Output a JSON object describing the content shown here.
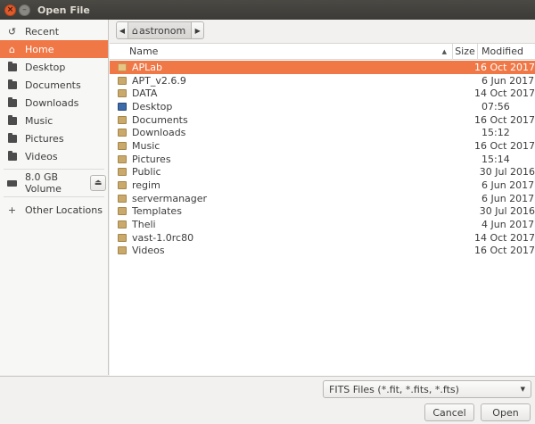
{
  "window": {
    "title": "Open File"
  },
  "sidebar": {
    "items": [
      {
        "label": "Recent",
        "icon": "recent-icon"
      },
      {
        "label": "Home",
        "icon": "home-icon",
        "selected": true
      },
      {
        "label": "Desktop",
        "icon": "folder-icon"
      },
      {
        "label": "Documents",
        "icon": "folder-icon"
      },
      {
        "label": "Downloads",
        "icon": "folder-icon"
      },
      {
        "label": "Music",
        "icon": "folder-icon"
      },
      {
        "label": "Pictures",
        "icon": "folder-icon"
      },
      {
        "label": "Videos",
        "icon": "folder-icon"
      }
    ],
    "volume": {
      "label": "8.0 GB Volume",
      "icon": "drive-icon",
      "eject_icon": "eject-icon"
    },
    "other": {
      "label": "Other Locations",
      "icon": "plus-icon"
    }
  },
  "pathbar": {
    "current": "astronom",
    "icon": "home-icon"
  },
  "columns": {
    "name": "Name",
    "size": "Size",
    "modified": "Modified"
  },
  "files": [
    {
      "name": "APLab",
      "size": "",
      "modified": "16 Oct 2017",
      "selected": true
    },
    {
      "name": "APT_v2.6.9",
      "size": "",
      "modified": "6 Jun 2017"
    },
    {
      "name": "DATA",
      "size": "",
      "modified": "14 Oct 2017"
    },
    {
      "name": "Desktop",
      "size": "",
      "modified": "07:56",
      "icon": "desktop"
    },
    {
      "name": "Documents",
      "size": "",
      "modified": "16 Oct 2017"
    },
    {
      "name": "Downloads",
      "size": "",
      "modified": "15:12"
    },
    {
      "name": "Music",
      "size": "",
      "modified": "16 Oct 2017"
    },
    {
      "name": "Pictures",
      "size": "",
      "modified": "15:14"
    },
    {
      "name": "Public",
      "size": "",
      "modified": "30 Jul 2016"
    },
    {
      "name": "regim",
      "size": "",
      "modified": "6 Jun 2017"
    },
    {
      "name": "servermanager",
      "size": "",
      "modified": "6 Jun 2017"
    },
    {
      "name": "Templates",
      "size": "",
      "modified": "30 Jul 2016"
    },
    {
      "name": "Theli",
      "size": "",
      "modified": "4 Jun 2017"
    },
    {
      "name": "vast-1.0rc80",
      "size": "",
      "modified": "14 Oct 2017"
    },
    {
      "name": "Videos",
      "size": "",
      "modified": "16 Oct 2017"
    }
  ],
  "filter": {
    "selected": "FITS Files (*.fit, *.fits, *.fts)"
  },
  "buttons": {
    "cancel": "Cancel",
    "open": "Open"
  },
  "colors": {
    "accent": "#f07746",
    "folder": "#c9a96c",
    "titlebar": "#3c3b37"
  }
}
